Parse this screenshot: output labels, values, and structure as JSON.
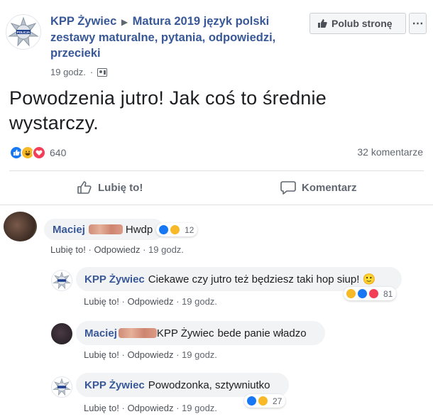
{
  "post": {
    "page_name": "KPP Żywiec",
    "group_name": "Matura 2019 język polski zestawy maturalne, pytania, odpowiedzi, przecieki",
    "time": "19 godz.",
    "like_page_label": "Polub stronę",
    "body": "Powodzenia jutro! Jak coś to średnie wystarczy.",
    "reaction_count": "640",
    "comment_count": "32 komentarze",
    "like_label": "Lubię to!",
    "comment_label": "Komentarz",
    "logo_text": "POLICJA"
  },
  "comments": [
    {
      "author": "Maciej",
      "text": "Hwdp",
      "reactions": "12",
      "like": "Lubię to!",
      "reply": "Odpowiedz",
      "time": "19 godz."
    },
    {
      "author": "KPP Żywiec",
      "text": "Ciekawe czy jutro też będziesz taki hop siup! 🙂",
      "reactions": "81",
      "like": "Lubię to!",
      "reply": "Odpowiedz",
      "time": "19 godz."
    },
    {
      "author": "Maciej",
      "mention": "KPP Żywiec",
      "text": "bede panie władzo",
      "like": "Lubię to!",
      "reply": "Odpowiedz",
      "time": "19 godz."
    },
    {
      "author": "KPP Żywiec",
      "text": "Powodzonka, sztywniutko",
      "reactions": "27",
      "like": "Lubię to!",
      "reply": "Odpowiedz",
      "time": "19 godz."
    }
  ],
  "colors": {
    "link": "#385898",
    "like": "#1877f2",
    "haha": "#f7b928",
    "love": "#f33e58"
  }
}
